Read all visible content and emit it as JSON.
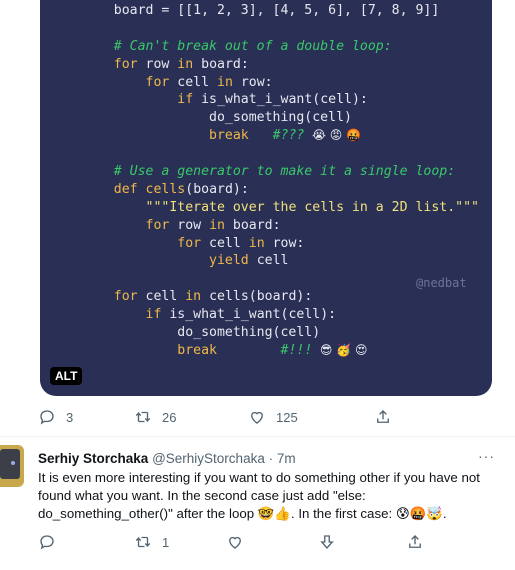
{
  "code_lines": [
    [
      {
        "t": "    board = [[1, 2, 3], [4, 5, 6], [7, 8, 9]]",
        "c": ""
      }
    ],
    [
      {
        "t": "",
        "c": ""
      }
    ],
    [
      {
        "t": "    # Can't break out of a double loop:",
        "c": "cm"
      }
    ],
    [
      {
        "t": "    ",
        "c": ""
      },
      {
        "t": "for",
        "c": "kw"
      },
      {
        "t": " row ",
        "c": ""
      },
      {
        "t": "in",
        "c": "kw"
      },
      {
        "t": " board:",
        "c": ""
      }
    ],
    [
      {
        "t": "        ",
        "c": ""
      },
      {
        "t": "for",
        "c": "kw"
      },
      {
        "t": " cell ",
        "c": ""
      },
      {
        "t": "in",
        "c": "kw"
      },
      {
        "t": " row:",
        "c": ""
      }
    ],
    [
      {
        "t": "            ",
        "c": ""
      },
      {
        "t": "if",
        "c": "kw"
      },
      {
        "t": " is_what_i_want(cell):",
        "c": ""
      }
    ],
    [
      {
        "t": "                do_something(cell)",
        "c": ""
      }
    ],
    [
      {
        "t": "                ",
        "c": ""
      },
      {
        "t": "break",
        "c": "kw"
      },
      {
        "t": "   #???",
        "c": "cm"
      },
      {
        "t": "  😭 😡 🤬",
        "c": "emoji"
      }
    ],
    [
      {
        "t": "",
        "c": ""
      }
    ],
    [
      {
        "t": "    # Use a generator to make it a single loop:",
        "c": "cm"
      }
    ],
    [
      {
        "t": "    ",
        "c": ""
      },
      {
        "t": "def",
        "c": "kw"
      },
      {
        "t": " ",
        "c": ""
      },
      {
        "t": "cells",
        "c": "kw"
      },
      {
        "t": "(board):",
        "c": ""
      }
    ],
    [
      {
        "t": "        ",
        "c": ""
      },
      {
        "t": "\"\"\"Iterate over the cells in a 2D list.\"\"\"",
        "c": "st"
      }
    ],
    [
      {
        "t": "        ",
        "c": ""
      },
      {
        "t": "for",
        "c": "kw"
      },
      {
        "t": " row ",
        "c": ""
      },
      {
        "t": "in",
        "c": "kw"
      },
      {
        "t": " board:",
        "c": ""
      }
    ],
    [
      {
        "t": "            ",
        "c": ""
      },
      {
        "t": "for",
        "c": "kw"
      },
      {
        "t": " cell ",
        "c": ""
      },
      {
        "t": "in",
        "c": "kw"
      },
      {
        "t": " row:",
        "c": ""
      }
    ],
    [
      {
        "t": "                ",
        "c": ""
      },
      {
        "t": "yield",
        "c": "kw"
      },
      {
        "t": " cell",
        "c": ""
      }
    ],
    [
      {
        "t": "",
        "c": ""
      }
    ],
    [
      {
        "t": "    ",
        "c": ""
      },
      {
        "t": "for",
        "c": "kw"
      },
      {
        "t": " cell ",
        "c": ""
      },
      {
        "t": "in",
        "c": "kw"
      },
      {
        "t": " cells(board):",
        "c": ""
      }
    ],
    [
      {
        "t": "        ",
        "c": ""
      },
      {
        "t": "if",
        "c": "kw"
      },
      {
        "t": " is_what_i_want(cell):",
        "c": ""
      }
    ],
    [
      {
        "t": "            do_something(cell)",
        "c": ""
      }
    ],
    [
      {
        "t": "            ",
        "c": ""
      },
      {
        "t": "break",
        "c": "kw"
      },
      {
        "t": "        #!!!",
        "c": "cm"
      },
      {
        "t": "  😎 🥳 😍",
        "c": "emoji"
      }
    ]
  ],
  "watermark": "@nedbat",
  "alt_label": "ALT",
  "tweet_actions": {
    "replies": "3",
    "retweets": "26",
    "likes": "125"
  },
  "reply": {
    "name": "Serhiy Storchaka",
    "handle": "@SerhiyStorchaka",
    "time": "7m",
    "more": "···",
    "text": "It is even more interesting if you want to do something other if you have not found what you want. In the second case just add \"else: do_something_other()\" after the loop 🤓👍. In the first case: 😰🤬🤯.",
    "actions": {
      "replies": "",
      "retweets": "1",
      "likes": ""
    }
  },
  "colors": {
    "code_bg": "#2a2f55",
    "keyword": "#f0b84a",
    "comment": "#39c86a",
    "string": "#f0e07a",
    "icon_gray": "#536471"
  }
}
